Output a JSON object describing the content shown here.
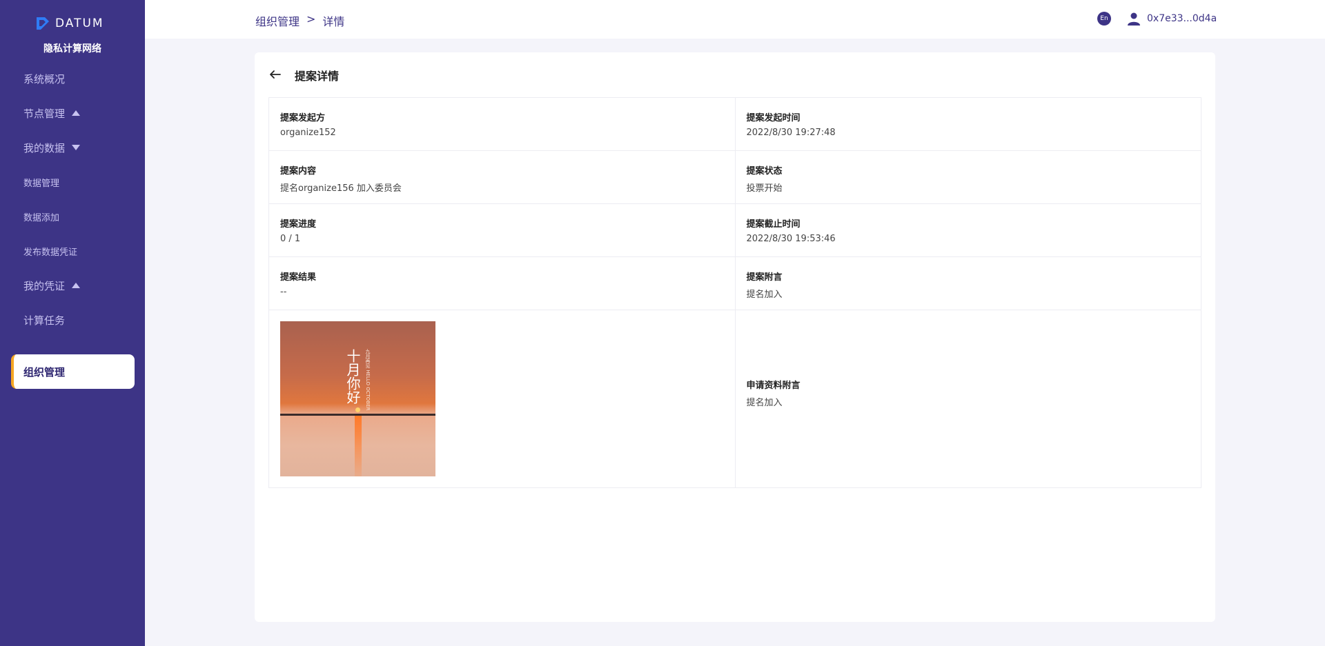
{
  "brand": {
    "name": "DATUM",
    "subtitle": "隐私计算网络"
  },
  "sidebar": {
    "items": [
      {
        "label": "系统概况"
      },
      {
        "label": "节点管理"
      },
      {
        "label": "我的数据"
      },
      {
        "label": "数据管理"
      },
      {
        "label": "数据添加"
      },
      {
        "label": "发布数据凭证"
      },
      {
        "label": "我的凭证"
      },
      {
        "label": "计算任务"
      },
      {
        "label": "组织管理"
      }
    ]
  },
  "header": {
    "breadcrumb": [
      "组织管理",
      ">",
      "详情"
    ],
    "lang": "En",
    "address": "0x7e33...0d4a"
  },
  "detail": {
    "title": "提案详情",
    "fields": [
      {
        "label": "提案发起方",
        "value": "organize152"
      },
      {
        "label": "提案发起时间",
        "value": "2022/8/30 19:27:48"
      },
      {
        "label": "提案内容",
        "value": "提名organize156 加入委员会"
      },
      {
        "label": "提案状态",
        "value": "投票开始"
      },
      {
        "label": "提案进度",
        "value": "0 / 1"
      },
      {
        "label": "提案截止时间",
        "value": "2022/8/30 19:53:46"
      },
      {
        "label": "提案结果",
        "value": "--"
      },
      {
        "label": "提案附言",
        "value": "提名加入"
      }
    ],
    "attachment": {
      "image_text": "十月你好",
      "image_small_text": "九月再见 HELLO OCTOBER",
      "label": "申请资料附言",
      "value": "提名加入"
    }
  },
  "colors": {
    "sidebar": "#3d3486",
    "accent": "#f5a623",
    "page_bg": "#f4f4fa"
  }
}
